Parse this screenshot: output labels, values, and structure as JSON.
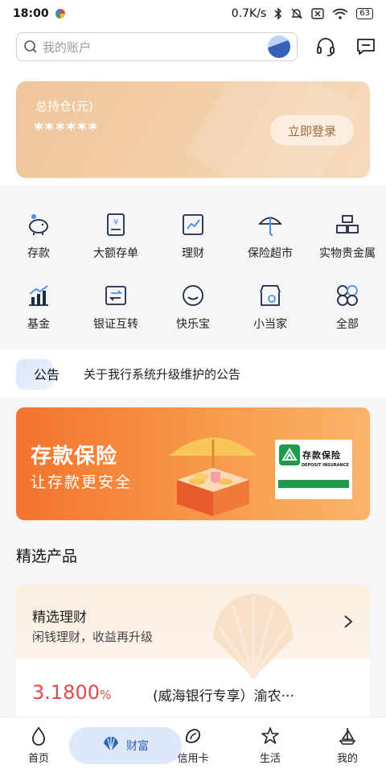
{
  "status_bar": {
    "time": "18:00",
    "network_speed": "0.7K/s",
    "battery": "63"
  },
  "search": {
    "placeholder": "我的账户"
  },
  "header_icons": [
    "headset-icon",
    "message-icon"
  ],
  "asset_card": {
    "title": "总持仓(元)",
    "value": "******",
    "login_label": "立即登录"
  },
  "grid": [
    {
      "label": "存款",
      "icon": "piggy-bank-icon"
    },
    {
      "label": "大额存单",
      "icon": "certificate-icon"
    },
    {
      "label": "理财",
      "icon": "trend-chart-icon"
    },
    {
      "label": "保险超市",
      "icon": "umbrella-icon"
    },
    {
      "label": "实物贵金属",
      "icon": "gold-bars-icon"
    },
    {
      "label": "基金",
      "icon": "fund-bars-icon"
    },
    {
      "label": "银证互转",
      "icon": "transfer-icon"
    },
    {
      "label": "快乐宝",
      "icon": "smile-icon"
    },
    {
      "label": "小当家",
      "icon": "shop-icon"
    },
    {
      "label": "全部",
      "icon": "all-grid-icon"
    }
  ],
  "notice": {
    "tag": "公告",
    "text": "关于我行系统升级维护的公告"
  },
  "banner": {
    "title": "存款保险",
    "subtitle": "让存款更安全",
    "badge_cn": "存款保险",
    "badge_en": "DEPOSIT INSURANCE"
  },
  "products": {
    "section_title": "精选产品",
    "card_title": "精选理财",
    "card_subtitle": "闲钱理财，收益再升级",
    "rate_value": "3.1800",
    "rate_unit": "%",
    "product_name": "(威海银行专享）渝农···"
  },
  "nav": {
    "home": "首页",
    "wealth": "财富",
    "credit": "信用卡",
    "life": "生活",
    "mine": "我的"
  },
  "colors": {
    "accent": "#2e62b8",
    "card_gold": "#efc59b",
    "banner_orange": "#f4732d",
    "rate_red": "#e24a4a"
  }
}
